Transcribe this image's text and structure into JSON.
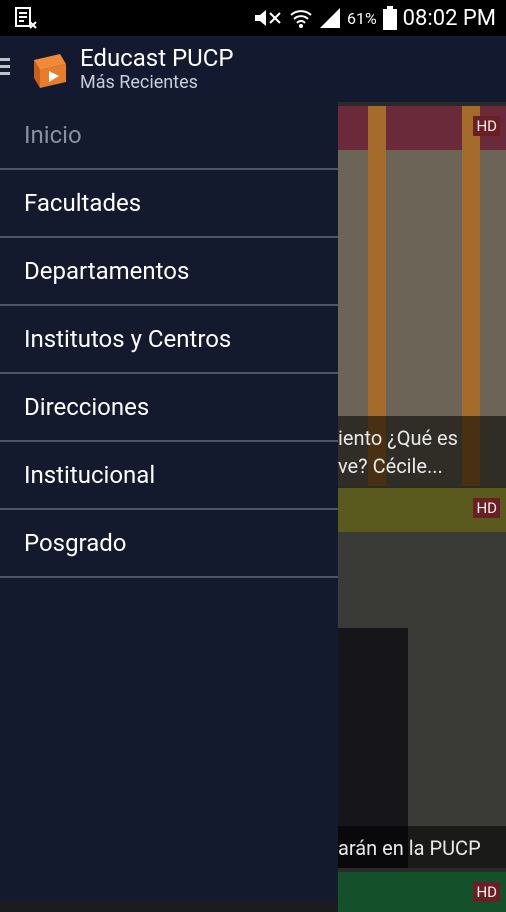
{
  "status_bar": {
    "time": "08:02 PM",
    "battery_percent": "61%"
  },
  "app_bar": {
    "title": "Educast PUCP",
    "subtitle": "Más Recientes"
  },
  "drawer": {
    "items": [
      {
        "label": "Inicio"
      },
      {
        "label": "Facultades"
      },
      {
        "label": "Departamentos"
      },
      {
        "label": "Institutos y Centros"
      },
      {
        "label": "Direcciones"
      },
      {
        "label": "Institucional"
      },
      {
        "label": "Posgrado"
      }
    ]
  },
  "content": {
    "cards": [
      {
        "badge": "HD",
        "caption": "iento  ¿Qué es\nve?  Cécile..."
      },
      {
        "badge": "HD",
        "caption": "arán en la PUCP"
      },
      {
        "badge": "HD"
      }
    ]
  },
  "colors": {
    "drawer_background": "#141a2e",
    "app_bar_background": "#131a30",
    "divider": "#4d5566",
    "hd_badge": "#6a1f25"
  }
}
